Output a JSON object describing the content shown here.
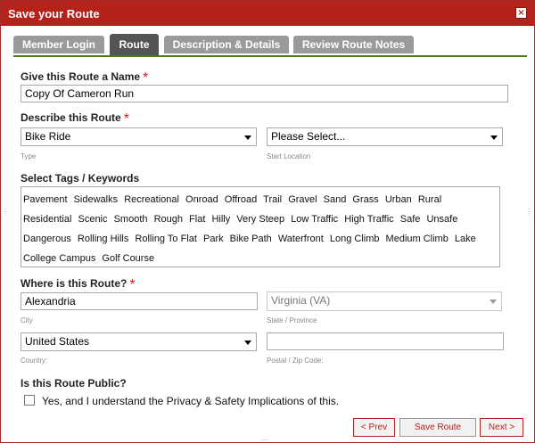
{
  "titlebar": {
    "title": "Save your Route",
    "close_glyph": "×"
  },
  "tabs": [
    {
      "label": "Member Login"
    },
    {
      "label": "Route"
    },
    {
      "label": "Description & Details"
    },
    {
      "label": "Review Route Notes"
    }
  ],
  "form": {
    "name_label": "Give this Route a Name",
    "name_value": "Copy Of Cameron Run",
    "describe_label": "Describe this Route",
    "type_value": "Bike Ride",
    "type_hint": "Type",
    "start_value": "Please Select...",
    "start_hint": "Start Location",
    "tags_label": "Select Tags / Keywords",
    "tags": [
      "Pavement",
      "Sidewalks",
      "Recreational",
      "Onroad",
      "Offroad",
      "Trail",
      "Gravel",
      "Sand",
      "Grass",
      "Urban",
      "Rural",
      "Residential",
      "Scenic",
      "Smooth",
      "Rough",
      "Flat",
      "Hilly",
      "Very Steep",
      "Low Traffic",
      "High Traffic",
      "Safe",
      "Unsafe",
      "Dangerous",
      "Rolling Hills",
      "Rolling To Flat",
      "Park",
      "Bike Path",
      "Waterfront",
      "Long Climb",
      "Medium Climb",
      "Lake",
      "College Campus",
      "Golf Course"
    ],
    "where_label": "Where is this Route?",
    "city_value": "Alexandria",
    "city_hint": "City",
    "state_value": "Virginia (VA)",
    "state_hint": "State / Province",
    "country_value": "United States",
    "country_hint": "Country:",
    "zip_value": "",
    "zip_hint": "Postal / Zip Code:",
    "public_label": "Is this Route Public?",
    "public_checkbox_label": "Yes, and I understand the Privacy & Safety Implications of this."
  },
  "buttons": {
    "prev": "< Prev",
    "save": "Save Route",
    "next": "Next >"
  },
  "colors": {
    "titlebar": "#b5221c",
    "active_tab": "#555555",
    "inactive_tab": "#9a9a9a",
    "required": "#d02020",
    "tab_underline": "#4a7a20"
  }
}
